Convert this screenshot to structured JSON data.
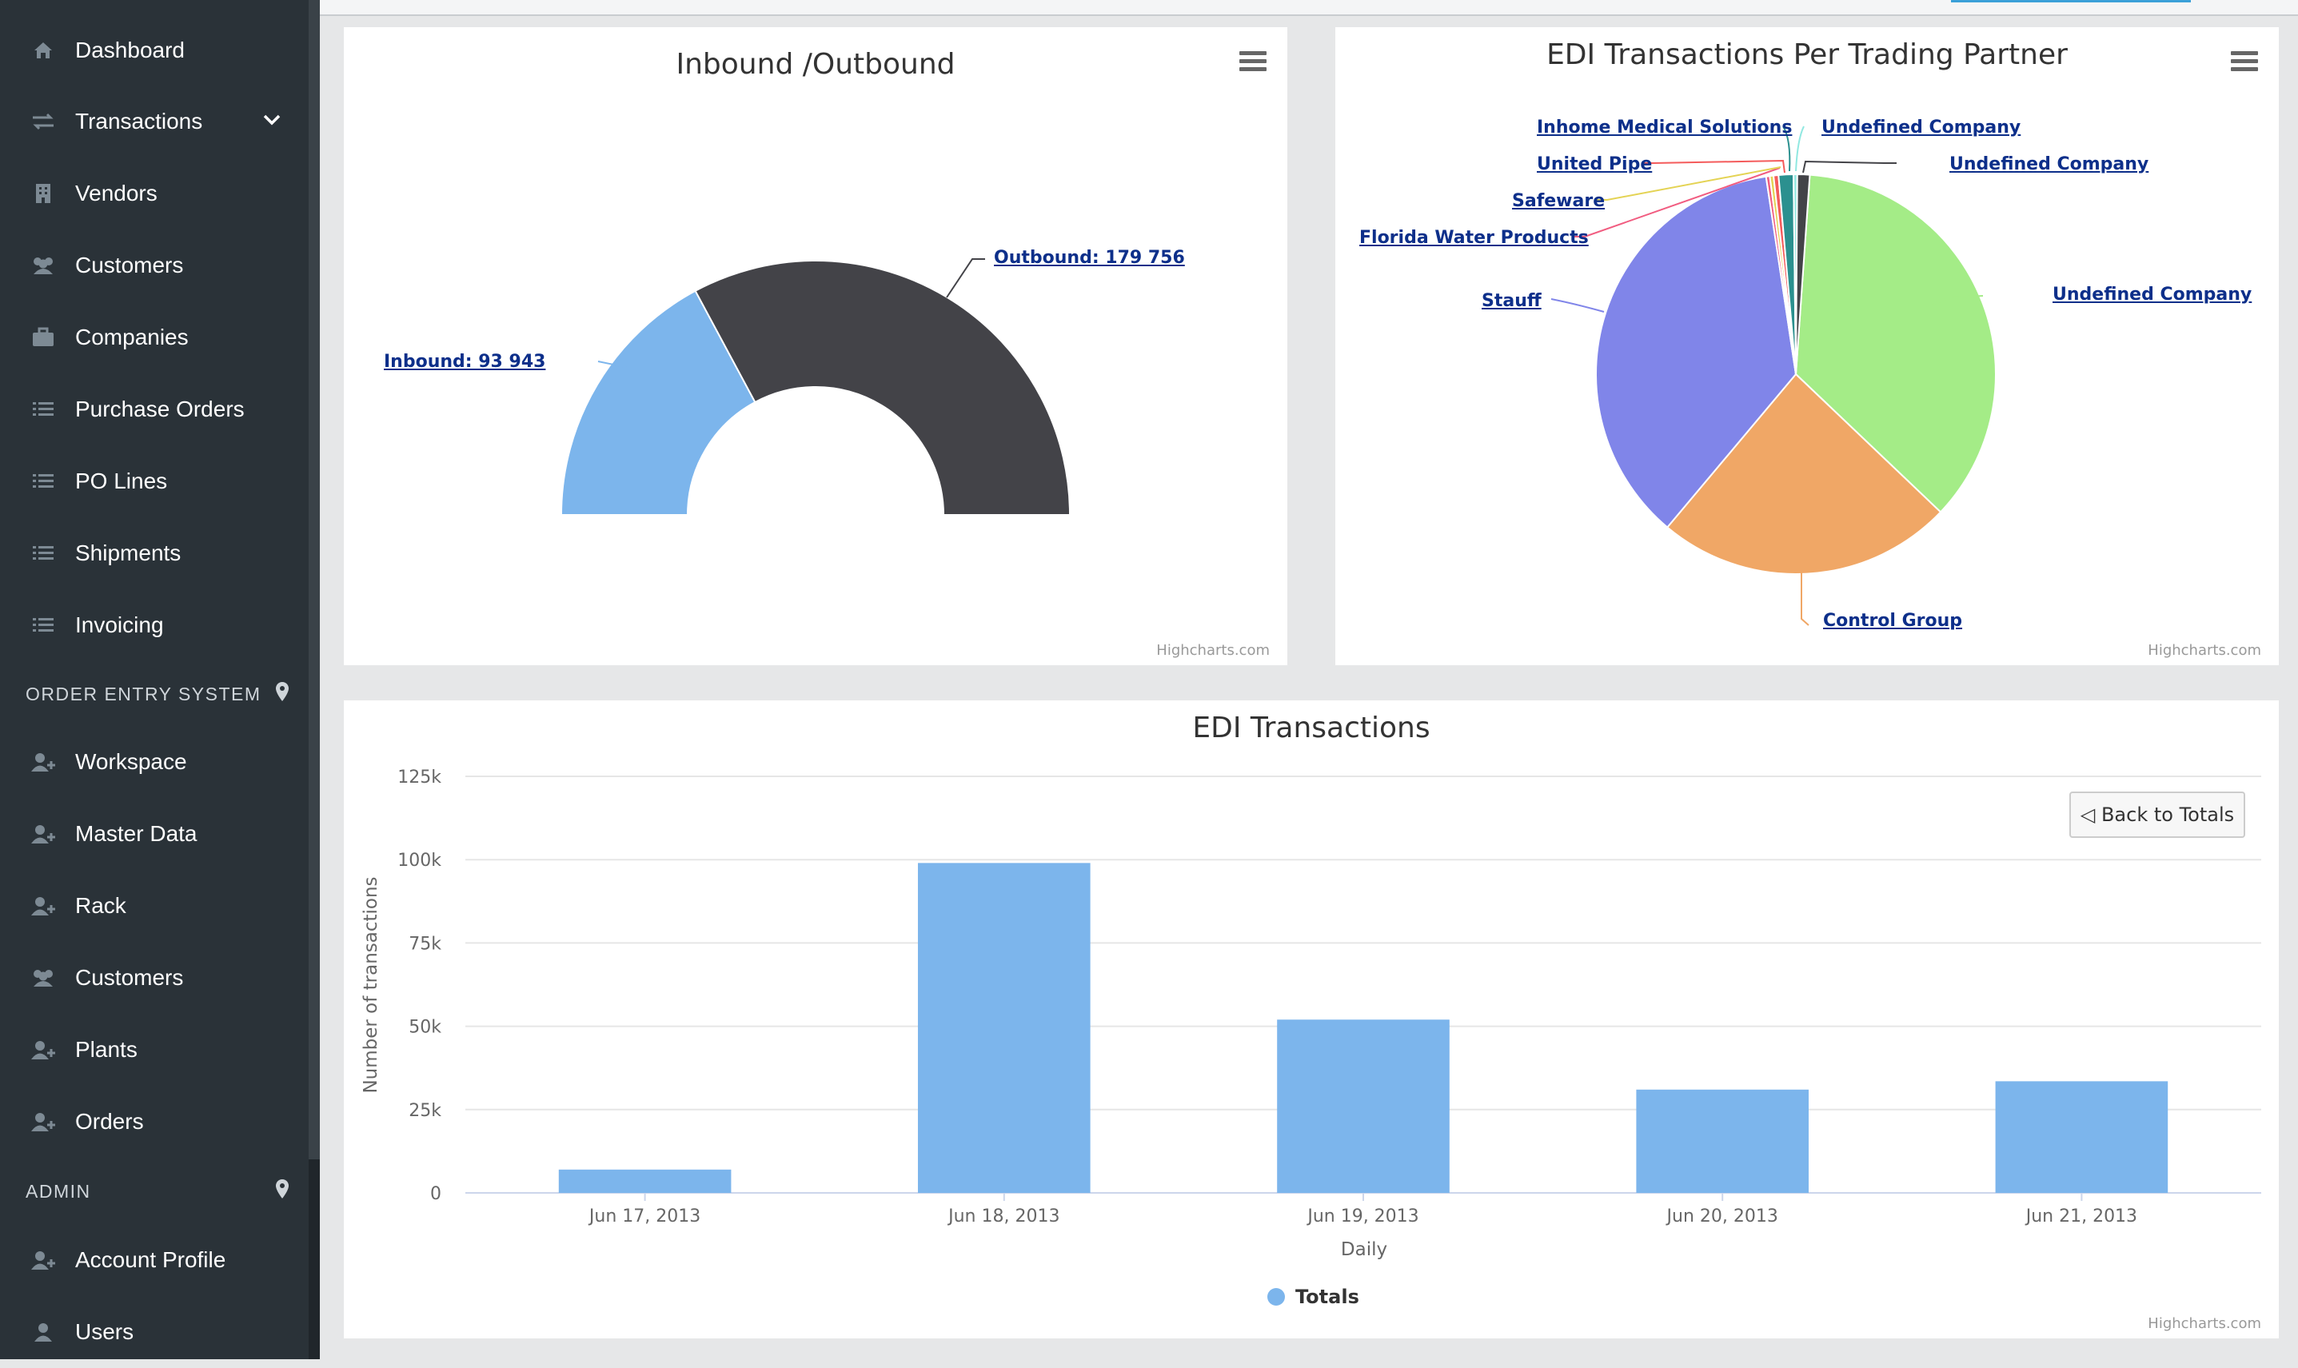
{
  "sidebar": {
    "items": [
      {
        "label": "Dashboard",
        "icon": "home-icon"
      },
      {
        "label": "Transactions",
        "icon": "exchange-icon"
      },
      {
        "label": "Vendors",
        "icon": "building-icon"
      },
      {
        "label": "Customers",
        "icon": "users-icon"
      },
      {
        "label": "Companies",
        "icon": "briefcase-icon"
      },
      {
        "label": "Purchase Orders",
        "icon": "list-icon"
      },
      {
        "label": "PO Lines",
        "icon": "list-icon"
      },
      {
        "label": "Shipments",
        "icon": "list-icon"
      },
      {
        "label": "Invoicing",
        "icon": "list-icon"
      }
    ],
    "section_order_entry": "ORDER ENTRY SYSTEM",
    "order_entry_items": [
      {
        "label": "Workspace",
        "icon": "user-plus-icon"
      },
      {
        "label": "Master Data",
        "icon": "user-plus-icon"
      },
      {
        "label": "Rack",
        "icon": "user-plus-icon"
      },
      {
        "label": "Customers",
        "icon": "users-icon"
      },
      {
        "label": "Plants",
        "icon": "user-plus-icon"
      },
      {
        "label": "Orders",
        "icon": "user-plus-icon"
      }
    ],
    "section_admin": "ADMIN",
    "admin_items": [
      {
        "label": "Account Profile",
        "icon": "user-plus-icon"
      },
      {
        "label": "Users",
        "icon": "user-icon"
      }
    ],
    "colors": {
      "background": "#2a3238",
      "icon": "#7d8a94"
    }
  },
  "credits": "Highcharts.com",
  "chart_data": [
    {
      "type": "pie",
      "variant": "semi-donut",
      "title": "Inbound /Outbound",
      "slices": [
        {
          "name": "Inbound",
          "value": 93943,
          "label": "Inbound: 93 943",
          "color": "#7cb5ec"
        },
        {
          "name": "Outbound",
          "value": 179756,
          "label": "Outbound: 179 756",
          "color": "#434348"
        }
      ]
    },
    {
      "type": "pie",
      "title": "EDI Transactions Per Trading Partner",
      "slices": [
        {
          "name": "Undefined Company",
          "value": 36.0,
          "color": "#a4ec87"
        },
        {
          "name": "Control Group",
          "value": 24.0,
          "color": "#f0a766"
        },
        {
          "name": "Stauff",
          "value": 36.5,
          "color": "#8085e9"
        },
        {
          "name": "Florida Water Products",
          "value": 0.3,
          "color": "#f15c80"
        },
        {
          "name": "Safeware",
          "value": 0.3,
          "color": "#e4d354"
        },
        {
          "name": "United Pipe",
          "value": 0.4,
          "color": "#f45b5b"
        },
        {
          "name": "Inhome Medical Solutions",
          "value": 1.2,
          "color": "#2b908f"
        },
        {
          "name": "Undefined Company",
          "value": 0.3,
          "color": "#91e8e1"
        },
        {
          "name": "Undefined Company",
          "value": 1.0,
          "color": "#434348"
        }
      ]
    },
    {
      "type": "bar",
      "title": "EDI Transactions",
      "categories": [
        "Jun 17, 2013",
        "Jun 18, 2013",
        "Jun 19, 2013",
        "Jun 20, 2013",
        "Jun 21, 2013"
      ],
      "series": [
        {
          "name": "Totals",
          "values": [
            7000,
            99000,
            52000,
            31000,
            33500
          ],
          "color": "#7cb5ec"
        }
      ],
      "xlabel": "Daily",
      "ylabel": "Number of transactions",
      "ylim": [
        0,
        125000
      ],
      "yticks": [
        "0",
        "25k",
        "50k",
        "75k",
        "100k",
        "125k"
      ],
      "grid": true,
      "legend": "bottom-center"
    }
  ],
  "bar_panel": {
    "back_button": "◁ Back to Totals"
  }
}
